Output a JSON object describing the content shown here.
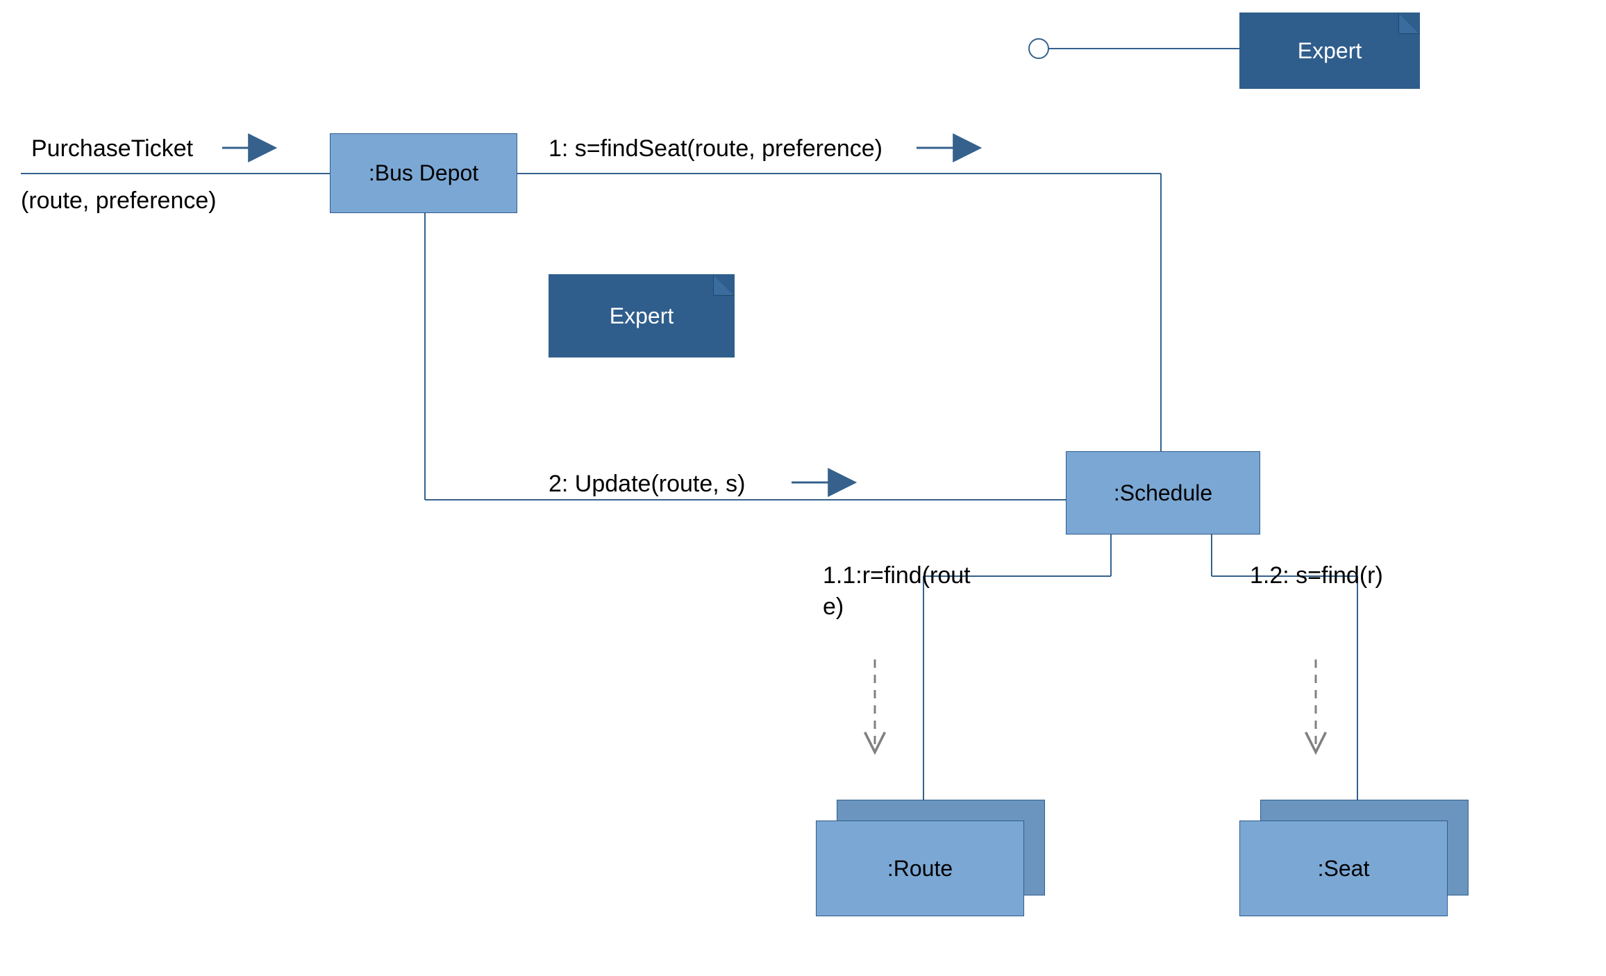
{
  "chart_data": {
    "type": "uml-communication",
    "objects": [
      {
        "name": ":Bus Depot"
      },
      {
        "name": ":Schedule"
      },
      {
        "name": ":Route",
        "multi": true
      },
      {
        "name": ":Seat",
        "multi": true
      }
    ],
    "notes": [
      "Expert",
      "Expert"
    ],
    "messages": [
      {
        "label": "PurchaseTicket",
        "args": "(route, preference)",
        "from": "actor",
        "to": ":Bus Depot"
      },
      {
        "label": "1: s=findSeat(route, preference)",
        "from": ":Bus Depot",
        "to": ":Schedule"
      },
      {
        "label": "2: Update(route, s)",
        "from": ":Bus Depot",
        "to": ":Schedule"
      },
      {
        "label": "1.1:r=find(route)",
        "from": ":Schedule",
        "to": ":Route"
      },
      {
        "label": "1.2: s=find(r)",
        "from": ":Schedule",
        "to": ":Seat"
      }
    ]
  },
  "labels": {
    "purchase_top": "PurchaseTicket",
    "purchase_bot": "(route, preference)",
    "msg1": "1: s=findSeat(route, preference)",
    "msg2": "2: Update(route, s)",
    "msg11a": "1.1:r=find(rout",
    "msg11b": "e)",
    "msg12": "1.2: s=find(r)"
  },
  "nodes": {
    "bus_depot": ":Bus Depot",
    "schedule": ":Schedule",
    "route": ":Route",
    "seat": ":Seat",
    "expert1": "Expert",
    "expert2": "Expert"
  },
  "colors": {
    "light": "#7ba7d4",
    "dark": "#2f5e8c",
    "line": "#35618c"
  }
}
